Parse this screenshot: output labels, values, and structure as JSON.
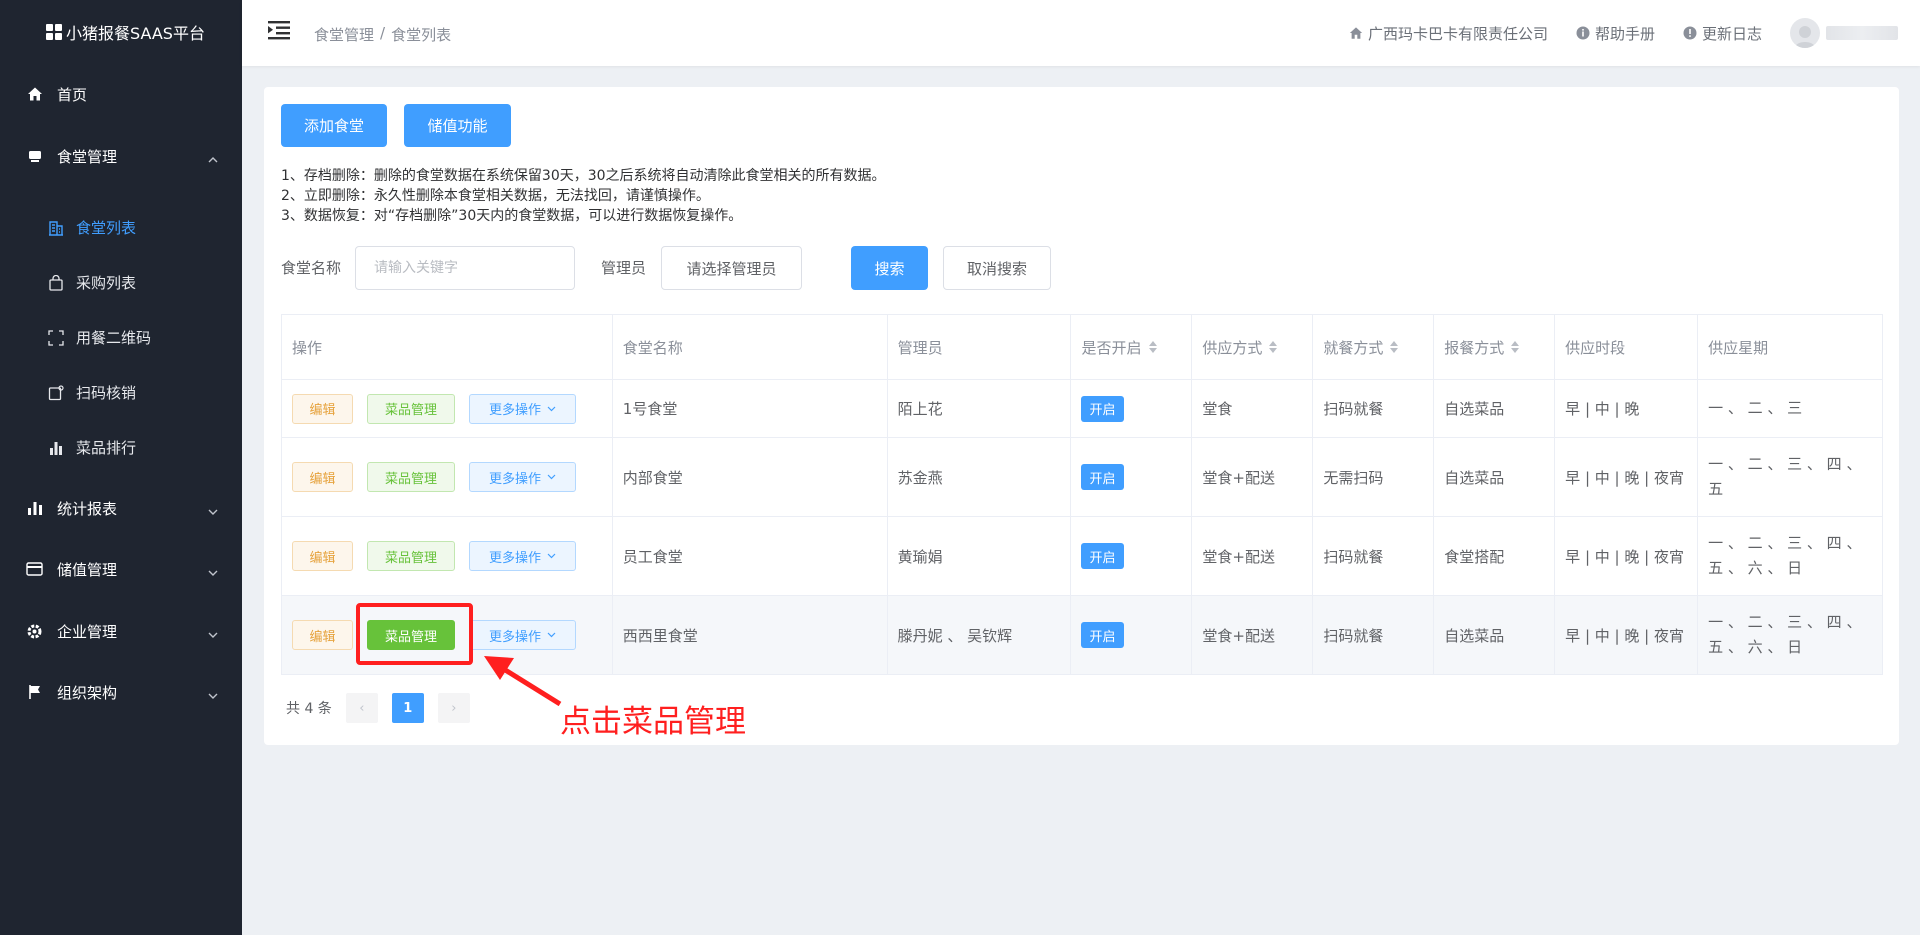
{
  "app": {
    "title": "小猪报餐SAAS平台"
  },
  "sidebar": {
    "items": [
      {
        "label": "首页",
        "icon": "home-icon"
      },
      {
        "label": "食堂管理",
        "icon": "canteen-icon",
        "expanded": true
      },
      {
        "label": "统计报表",
        "icon": "bar-chart-icon"
      },
      {
        "label": "储值管理",
        "icon": "card-icon"
      },
      {
        "label": "企业管理",
        "icon": "gear-icon"
      },
      {
        "label": "组织架构",
        "icon": "flag-icon"
      }
    ],
    "sub_items": [
      {
        "label": "食堂列表",
        "icon": "building-icon",
        "active": true
      },
      {
        "label": "采购列表",
        "icon": "bag-icon"
      },
      {
        "label": "用餐二维码",
        "icon": "scan-icon"
      },
      {
        "label": "扫码核销",
        "icon": "verify-icon"
      },
      {
        "label": "菜品排行",
        "icon": "rank-icon"
      }
    ]
  },
  "header": {
    "breadcrumb": [
      "食堂管理",
      "/",
      "食堂列表"
    ],
    "company": "广西玛卡巴卡有限责任公司",
    "help": "帮助手册",
    "changelog": "更新日志"
  },
  "toolbar": {
    "add_label": "添加食堂",
    "stored_value_label": "储值功能"
  },
  "notes": [
    "1、存档删除：删除的食堂数据在系统保留30天，30之后系统将自动清除此食堂相关的所有数据。",
    "2、立即删除：永久性删除本食堂相关数据，无法找回，请谨慎操作。",
    "3、数据恢复：对“存档删除”30天内的食堂数据，可以进行数据恢复操作。"
  ],
  "search": {
    "name_label": "食堂名称",
    "name_placeholder": "请输入关键字",
    "admin_label": "管理员",
    "admin_select": "请选择管理员",
    "search_label": "搜索",
    "cancel_label": "取消搜索"
  },
  "table": {
    "headers": [
      "操作",
      "食堂名称",
      "管理员",
      "是否开启",
      "供应方式",
      "就餐方式",
      "报餐方式",
      "供应时段",
      "供应星期"
    ],
    "op_labels": {
      "edit": "编辑",
      "dish": "菜品管理",
      "more": "更多操作"
    },
    "rows": [
      {
        "name": "1号食堂",
        "admin": "陌上花",
        "enabled": "开启",
        "supply": "堂食",
        "dining": "扫码就餐",
        "order": "自选菜品",
        "times": "早 | 中 | 晚",
        "days": [
          "一 、 二 、 三"
        ]
      },
      {
        "name": "内部食堂",
        "admin": "苏金燕",
        "enabled": "开启",
        "supply": "堂食+配送",
        "dining": "无需扫码",
        "order": "自选菜品",
        "times": "早 | 中 | 晚 | 夜宵",
        "days": [
          "一 、 二 、 三 、 四 、",
          "五"
        ]
      },
      {
        "name": "员工食堂",
        "admin": "黄瑜娟",
        "enabled": "开启",
        "supply": "堂食+配送",
        "dining": "扫码就餐",
        "order": "食堂搭配",
        "times": "早 | 中 | 晚 | 夜宵",
        "days": [
          "一 、 二 、 三 、 四 、",
          "五 、 六 、 日"
        ]
      },
      {
        "name": "西西里食堂",
        "admin": "滕丹妮 、 吴钦辉",
        "enabled": "开启",
        "supply": "堂食+配送",
        "dining": "扫码就餐",
        "order": "自选菜品",
        "times": "早 | 中 | 晚 | 夜宵",
        "days": [
          "一 、 二 、 三 、 四 、",
          "五 、 六 、 日"
        ]
      }
    ]
  },
  "pagination": {
    "total": "共 4 条",
    "current": "1",
    "prev": "‹",
    "next": "›"
  },
  "annotation": {
    "text": "点击菜品管理"
  },
  "colors": {
    "primary": "#409eff",
    "success": "#67c23a",
    "warning": "#e6a23c",
    "sidebar": "#1f2530",
    "annotation": "#ff1f1f"
  }
}
